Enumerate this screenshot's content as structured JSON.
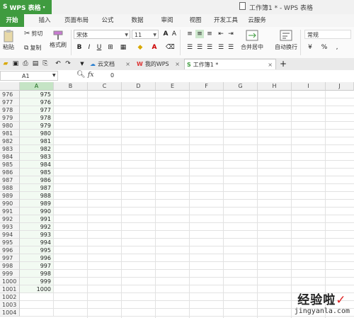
{
  "titlebar": {
    "app_label": "WPS 表格",
    "doc_title": "工作簿1 * - WPS 表格"
  },
  "menu_tabs": [
    "开始",
    "插入",
    "页面布局",
    "公式",
    "数据",
    "审阅",
    "视图",
    "开发工具",
    "云服务"
  ],
  "ribbon": {
    "paste": "粘贴",
    "cut": "剪切",
    "copy": "复制",
    "format_painter": "格式刷",
    "font_name": "宋体",
    "font_size": "11",
    "bold": "B",
    "italic": "I",
    "underline": "U",
    "merge_center": "合并居中",
    "wrap_text": "自动换行",
    "number_format": "常规",
    "percent": "%"
  },
  "doc_tabs": [
    {
      "label": "云文档",
      "active": false
    },
    {
      "label": "我的WPS",
      "active": false
    },
    {
      "label": "工作簿1 *",
      "active": true
    }
  ],
  "formula_bar": {
    "cell_ref": "A1",
    "fx": "fx",
    "content": "0"
  },
  "grid": {
    "columns": [
      "A",
      "B",
      "C",
      "D",
      "E",
      "F",
      "G",
      "H",
      "I",
      "J"
    ],
    "rows": [
      {
        "n": "976",
        "a": "975"
      },
      {
        "n": "977",
        "a": "976"
      },
      {
        "n": "978",
        "a": "977"
      },
      {
        "n": "979",
        "a": "978"
      },
      {
        "n": "980",
        "a": "979"
      },
      {
        "n": "981",
        "a": "980"
      },
      {
        "n": "982",
        "a": "981"
      },
      {
        "n": "983",
        "a": "982"
      },
      {
        "n": "984",
        "a": "983"
      },
      {
        "n": "985",
        "a": "984"
      },
      {
        "n": "986",
        "a": "985"
      },
      {
        "n": "987",
        "a": "986"
      },
      {
        "n": "988",
        "a": "987"
      },
      {
        "n": "989",
        "a": "988"
      },
      {
        "n": "990",
        "a": "989"
      },
      {
        "n": "991",
        "a": "990"
      },
      {
        "n": "992",
        "a": "991"
      },
      {
        "n": "993",
        "a": "992"
      },
      {
        "n": "994",
        "a": "993"
      },
      {
        "n": "995",
        "a": "994"
      },
      {
        "n": "996",
        "a": "995"
      },
      {
        "n": "997",
        "a": "996"
      },
      {
        "n": "998",
        "a": "997"
      },
      {
        "n": "999",
        "a": "998"
      },
      {
        "n": "1000",
        "a": "999"
      },
      {
        "n": "1001",
        "a": "1000"
      },
      {
        "n": "1002",
        "a": ""
      },
      {
        "n": "1003",
        "a": ""
      },
      {
        "n": "1004",
        "a": ""
      }
    ]
  },
  "watermark": {
    "line1": "经验啦",
    "check": "✓",
    "line2": "jingyanla.com"
  },
  "colors": {
    "accent": "#3f9b3f",
    "selected_col": "#c5e4c5"
  }
}
